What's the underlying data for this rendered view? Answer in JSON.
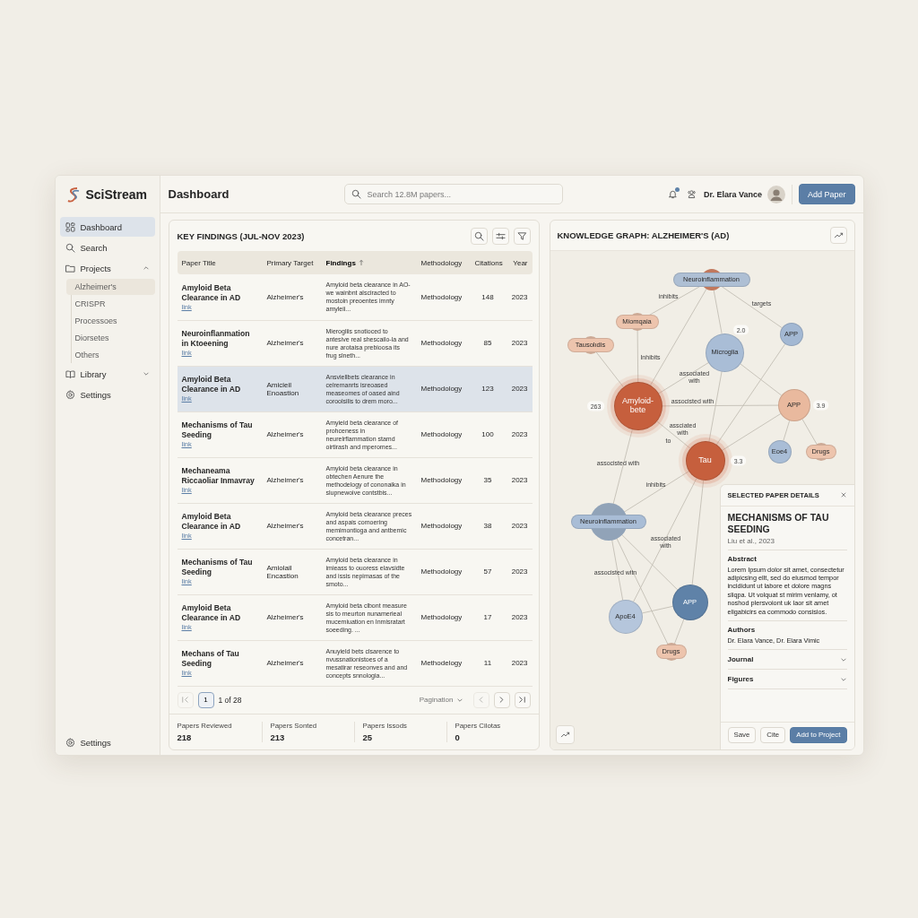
{
  "app": {
    "name": "SciStream"
  },
  "sidebar": {
    "items": [
      {
        "label": "Dashboard",
        "selected": true
      },
      {
        "label": "Search",
        "selected": false
      },
      {
        "label": "Projects",
        "selected": false,
        "expanded": true,
        "children": [
          {
            "label": "Alzheimer's",
            "selected": true
          },
          {
            "label": "CRISPR",
            "selected": false
          },
          {
            "label": "Processoes",
            "selected": false
          },
          {
            "label": "Diorsetes",
            "selected": false
          },
          {
            "label": "Others",
            "selected": false
          }
        ]
      },
      {
        "label": "Library",
        "selected": false,
        "expanded": false
      },
      {
        "label": "Settings",
        "selected": false
      }
    ],
    "footer": {
      "label": "Settings"
    }
  },
  "header": {
    "title": "Dashboard",
    "search": {
      "placeholder": "Search 12.8M papers..."
    },
    "notifications": {
      "unread": true
    },
    "user": {
      "name": "Dr. Elara Vance"
    },
    "primary_button": "Add Paper"
  },
  "findings": {
    "title": "KEY FINDINGS (JUL-NOV 2023)",
    "columns": [
      {
        "label": "Paper Title",
        "sorted": false
      },
      {
        "label": "Primary Target",
        "sorted": false
      },
      {
        "label": "Findings",
        "sorted": true
      },
      {
        "label": "Methodology",
        "sorted": false
      },
      {
        "label": "Citations",
        "sorted": false
      },
      {
        "label": "Year",
        "sorted": false
      }
    ],
    "rows": [
      {
        "title": "Amyloid Beta Clearance in AD",
        "link": "link",
        "target": "Alzheimer's",
        "findings": "Amyloid beta clearance in AO-we wainbnt alsciracted to mostoin preoentes imnty amyleii...",
        "methodology": "Methodology",
        "citations": "148",
        "year": "2023",
        "selected": false
      },
      {
        "title": "Neuroinflanmation in Ktoeening",
        "link": "link",
        "target": "Alzheimer's",
        "findings": "Mierogliis snotioced to antesive real shescailo-la and nure arotaisa prebioosa its frug slneth...",
        "methodology": "Methodology",
        "citations": "85",
        "year": "2023",
        "selected": false
      },
      {
        "title": "Amyloid Beta Clearance in AD",
        "link": "link",
        "target": "Amicieil Enoastion",
        "findings": "Ansviellbets clearance in celremanrts isreoased measeomes of oased aind coroolsilis to drem moro...",
        "methodology": "Methodology",
        "citations": "123",
        "year": "2023",
        "selected": true
      },
      {
        "title": "Mechanisms of Tau Seeding",
        "link": "link",
        "target": "Alzheimer's",
        "findings": "Amyield beta clearance of prohceness in neurelrflammation stamd oirtirash and mperomes...",
        "methodology": "Methodology",
        "citations": "100",
        "year": "2023",
        "selected": false
      },
      {
        "title": "Mechaneama Riccaoliar Inmavray",
        "link": "link",
        "target": "Alzheimer's",
        "findings": "Amyloid beta clearance in obtechen Aenure the methodelogy of cononaika in slupnewoive contstbis...",
        "methodology": "Methodology",
        "citations": "35",
        "year": "2023",
        "selected": false
      },
      {
        "title": "Amyloid Beta Clearance in AD",
        "link": "link",
        "target": "Alzheimer's",
        "findings": "Amyloid beta clearance preces and aspais comoering memimontioga and antbemic concetran...",
        "methodology": "Methodology",
        "citations": "38",
        "year": "2023",
        "selected": false
      },
      {
        "title": "Mechanisms of Tau Seeding",
        "link": "link",
        "target": "Amiolail Encastion",
        "findings": "Amyloid beta clearance in imieass to ouoress elavsidte and issis nepimasas of the smoto...",
        "methodology": "Methodology",
        "citations": "57",
        "year": "2023",
        "selected": false
      },
      {
        "title": "Amyloid Beta Clearance in AD",
        "link": "link",
        "target": "Alzheimer's",
        "findings": "Amyloid beta clbont measure sis to meurton nunamerieal mucemiuation en Inmisratart soeeding. ...",
        "methodology": "Methodology",
        "citations": "17",
        "year": "2023",
        "selected": false
      },
      {
        "title": "Mechans of Tau Seeding",
        "link": "link",
        "target": "Alzheimer's",
        "findings": "Anuyield bets clsarence to nvussnationistoes of a mesatirar reseonves and and concepts snnologia...",
        "methodology": "Methodelogy",
        "citations": "11",
        "year": "2023",
        "selected": false
      }
    ],
    "pagination": {
      "page": "1",
      "summary": "1 of 28",
      "menu": "Pagination",
      "nav": [
        {
          "disabled": true
        },
        {
          "disabled": true
        },
        {
          "disabled": false
        },
        {
          "disabled": false
        }
      ]
    },
    "stats": [
      {
        "label": "Papers Reviewed",
        "value": "218"
      },
      {
        "label": "Papers Sonted",
        "value": "213"
      },
      {
        "label": "Papers Issods",
        "value": "25"
      },
      {
        "label": "Papers Cilotas",
        "value": "0"
      }
    ]
  },
  "graph": {
    "title": "KNOWLEDGE GRAPH: ALZHEIMER'S (AD)",
    "nodes": [
      {
        "label": "Neuroinflammation",
        "kind": "pill",
        "color": "#aebfd4",
        "highlighted": false
      },
      {
        "label": "Miomqaia",
        "kind": "pill",
        "color": "#edc4ad",
        "highlighted": false
      },
      {
        "label": "Tausolıdis",
        "kind": "pill",
        "color": "#edc4ad",
        "highlighted": false
      },
      {
        "label": "Microglia",
        "kind": "circle",
        "color": "#a9bdd6",
        "highlighted": false,
        "badge": "2.0"
      },
      {
        "label": "APP",
        "kind": "circle",
        "color": "#a3b8d3",
        "highlighted": false
      },
      {
        "label": "Amyloid-bete",
        "kind": "circle",
        "color": "#c65f3d",
        "highlighted": true,
        "badge": "263"
      },
      {
        "label": "APP",
        "kind": "circle",
        "color": "#e9b99e",
        "highlighted": false,
        "badge": "3.9"
      },
      {
        "label": "Eoe4",
        "kind": "circle",
        "color": "#a9bdd6",
        "highlighted": false
      },
      {
        "label": "Drugs",
        "kind": "pill",
        "color": "#edc4ad",
        "highlighted": false
      },
      {
        "label": "Tau",
        "kind": "circle",
        "color": "#c65f3d",
        "highlighted": true,
        "badge": "3.3"
      },
      {
        "label": "Neuroinflammation",
        "kind": "pill",
        "color": "#a9bdd6",
        "highlighted": false
      },
      {
        "label": "ApoE4",
        "kind": "circle",
        "color": "#b5c6dc",
        "highlighted": false
      },
      {
        "label": "APP",
        "kind": "circle",
        "color": "#5f82a8",
        "highlighted": false
      },
      {
        "label": "Drugs",
        "kind": "pill",
        "color": "#edc4ad",
        "highlighted": false
      }
    ],
    "edge_labels": [
      "inhibits",
      "targets",
      "Inhibits",
      "associated with",
      "associsted with",
      "assciated with",
      "to",
      "associsted with",
      "inhibits",
      "associated with",
      "associsted witn"
    ]
  },
  "details": {
    "title": "SELECTED PAPER DETAILS",
    "paper_title": "MECHANISMS OF TAU SEEDING",
    "citation": "Liu et al., 2023",
    "sections": [
      {
        "heading": "Abstract",
        "text": "Lorem Ipsum dolor sit amet, consectetur adipicsing ellt, sed do elusmod tempor incididunt ut labore et dolore magns sliqpa. Ut volquat st mirim venlamy, ot noshod plersvoiont uk laor sit amet eligabicirs ea commodo consisios."
      },
      {
        "heading": "Authors",
        "text": "Dr. Elara Vance, Dr. Elara Vimic"
      }
    ],
    "accordions": [
      {
        "label": "Journal",
        "expanded": false
      },
      {
        "label": "Figures",
        "expanded": false
      }
    ],
    "buttons": [
      {
        "label": "Save",
        "kind": "secondary"
      },
      {
        "label": "Cite",
        "kind": "secondary"
      },
      {
        "label": "Add to Project",
        "kind": "primary"
      }
    ]
  }
}
